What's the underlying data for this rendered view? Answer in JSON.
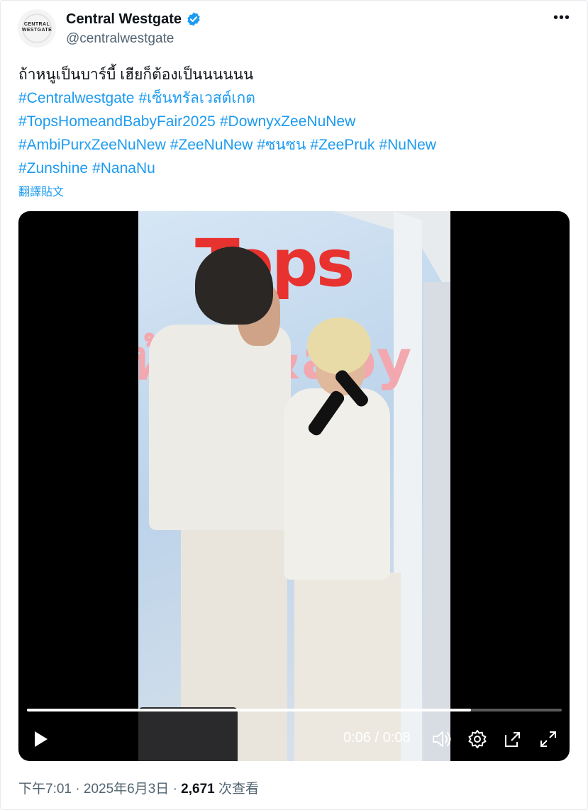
{
  "author": {
    "display_name": "Central Westgate",
    "handle": "@centralwestgate",
    "avatar_text_line1": "CENTRAL",
    "avatar_text_line2": "WESTGATE",
    "verified": true
  },
  "more_icon": "more-horizontal-icon",
  "tweet": {
    "text": "ถ้าหนูเป็นบาร์บี้ เฮียก็ต้องเป็นนนนนน",
    "hashtag_lines": [
      [
        "#Centralwestgate",
        "#เซ็นทรัลเวสต์เกต"
      ],
      [
        "#TopsHomeandBabyFair2025",
        "#DownyxZeeNuNew"
      ],
      [
        "#AmbiPurxZeeNuNew",
        "#ZeeNuNew",
        "#ซนซน",
        "#ZeePruk",
        "#NuNew"
      ],
      [
        "#Zunshine",
        "#NanaNu"
      ]
    ],
    "translate_label": "翻譯貼文"
  },
  "video": {
    "sign_text": "Tops",
    "sign_subtext": "ห้อ e&aby",
    "current_time": "0:06",
    "separator": "/",
    "duration": "0:08",
    "progress_fraction": 0.83,
    "controls": [
      "play-icon",
      "volume-icon",
      "settings-icon",
      "popout-icon",
      "fullscreen-icon"
    ]
  },
  "meta": {
    "time": "下午7:01",
    "dot1": "·",
    "date": "2025年6月3日",
    "dot2": "·",
    "views_count": "2,671",
    "views_label": "次查看"
  },
  "colors": {
    "accent": "#1d9bf0",
    "text": "#0f1419",
    "secondary": "#536471"
  }
}
